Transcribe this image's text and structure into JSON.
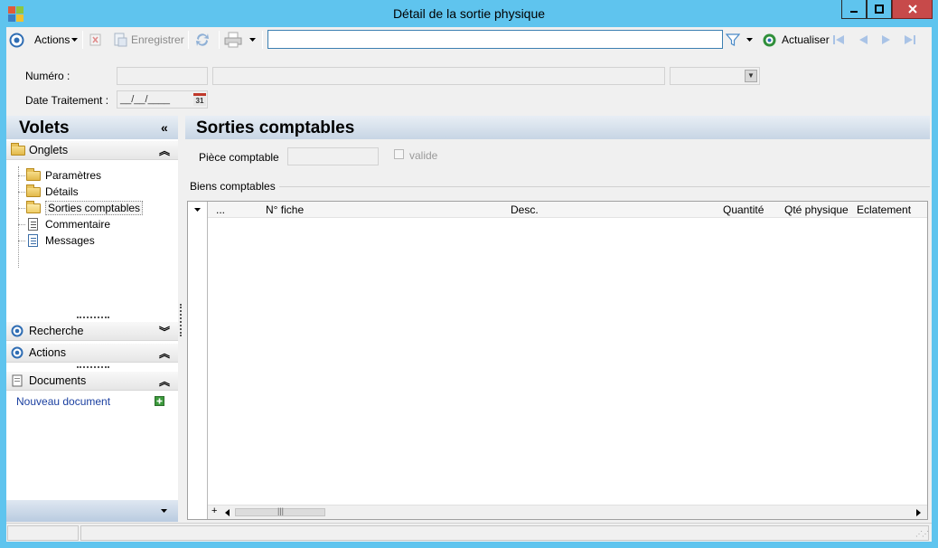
{
  "window": {
    "title": "Détail de la sortie physique"
  },
  "toolbar": {
    "actions_label": "Actions",
    "save_label": "Enregistrer",
    "refresh_label": "Actualiser",
    "search_value": ""
  },
  "form": {
    "numero_label": "Numéro :",
    "date_label": "Date Traitement :",
    "date_value": "__/__/____",
    "calendar_day": "31"
  },
  "left_pane": {
    "title": "Volets",
    "tabs_section": "Onglets",
    "tree_items": [
      "Paramètres",
      "Détails",
      "Sorties comptables",
      "Commentaire",
      "Messages"
    ],
    "search_section": "Recherche",
    "actions_section": "Actions",
    "documents_section": "Documents",
    "new_document": "Nouveau document"
  },
  "right_pane": {
    "title": "Sorties comptables",
    "piece_label": "Pièce comptable",
    "valid_label": "valide",
    "group_label": "Biens comptables",
    "columns": [
      "...",
      "N° fiche",
      "Desc.",
      "Quantité",
      "Qté physique",
      "Eclatement"
    ]
  },
  "colors": {
    "titlebar": "#5fc4ee",
    "close_button": "#c74a4a",
    "pane_header": "#c7d5e4",
    "link": "#1a3fa0"
  }
}
